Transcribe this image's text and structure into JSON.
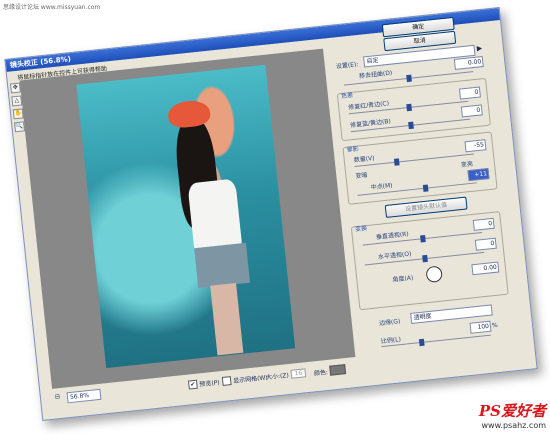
{
  "top_watermark": "思缘设计论坛 www.missyuan.com",
  "dialog": {
    "title": "镜头校正 (56.8%)",
    "hint": "将鼠标指针放在控件上可获得帮助"
  },
  "tools": [
    "✥",
    "△",
    "✋",
    "🔍"
  ],
  "status": {
    "zoom": "56.8%",
    "preview_label": "预览(P)",
    "preview_checked": true,
    "grid_label": "显示网格(W)",
    "grid_checked": false,
    "size_label": "大小:(Z)",
    "size_value": "16",
    "color_label": "颜色:"
  },
  "panel": {
    "ok_label": "确定",
    "cancel_label": "取消",
    "settings_label": "设置(E):",
    "settings_value": "自定",
    "distortion_label": "移去扭曲(D)",
    "distortion_value": "0.00",
    "chroma_section": "色差",
    "red_cyan_label": "修复红/青边(C)",
    "red_cyan_value": "0",
    "blue_yellow_label": "修复蓝/黄边(B)",
    "blue_yellow_value": "0",
    "vignette_section": "晕影",
    "amount_label": "数量(V)",
    "amount_value": "-55",
    "darken_label": "变暗",
    "lighten_label": "变亮",
    "midpoint_label": "中点(M)",
    "midpoint_value": "+11",
    "default_button": "设置镜头默认值",
    "transform_section": "变换",
    "vertical_label": "垂直透视(R)",
    "vertical_value": "0",
    "horizontal_label": "水平透视(O)",
    "horizontal_value": "0",
    "angle_label": "角度(A)",
    "angle_value": "0.00",
    "edge_label": "边缘(G)",
    "edge_value": "透明度",
    "scale_label": "比例(L)",
    "scale_value": "100",
    "scale_unit": "%"
  },
  "watermark": {
    "logo": "PS爱好者",
    "url": "www.psahz.com"
  }
}
